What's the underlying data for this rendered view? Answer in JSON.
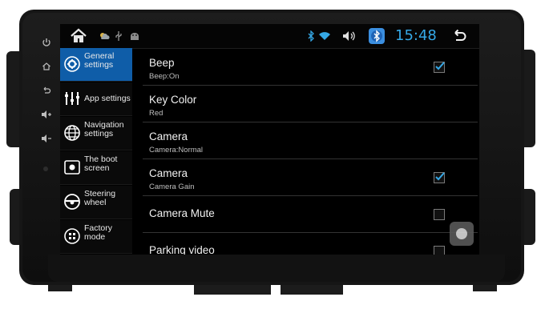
{
  "device": {
    "side_keys": [
      "power-icon",
      "home-icon",
      "back-icon",
      "volume-up-icon",
      "volume-down-icon"
    ]
  },
  "statusbar": {
    "time": "15:48",
    "icons": [
      "home-icon",
      "weather-icon",
      "usb-icon",
      "android-icon",
      "bluetooth-icon",
      "wifi-icon",
      "volume-icon",
      "bluetooth-app-icon",
      "back-icon"
    ],
    "accent": "#35a8e6"
  },
  "sidebar": {
    "items": [
      {
        "label": "General settings",
        "icon": "gear-icon",
        "active": true
      },
      {
        "label": "App settings",
        "icon": "sliders-icon",
        "active": false
      },
      {
        "label": "Navigation settings",
        "icon": "globe-icon",
        "active": false
      },
      {
        "label": "The boot screen",
        "icon": "boot-screen-icon",
        "active": false
      },
      {
        "label": "Steering wheel",
        "icon": "steering-wheel-icon",
        "active": false
      },
      {
        "label": "Factory mode",
        "icon": "factory-icon",
        "active": false
      }
    ],
    "active_color": "#0f5da8"
  },
  "settings": [
    {
      "title": "Beep",
      "subtitle": "Beep:On",
      "checkbox": true,
      "checked": true
    },
    {
      "title": "Key Color",
      "subtitle": "Red",
      "checkbox": false
    },
    {
      "title": "Camera",
      "subtitle": "Camera:Normal",
      "checkbox": false
    },
    {
      "title": "Camera",
      "subtitle": "Camera Gain",
      "checkbox": true,
      "checked": true
    },
    {
      "title": "Camera Mute",
      "subtitle": "",
      "checkbox": true,
      "checked": false
    },
    {
      "title": "Parking video",
      "subtitle": "",
      "checkbox": true,
      "checked": false
    }
  ]
}
